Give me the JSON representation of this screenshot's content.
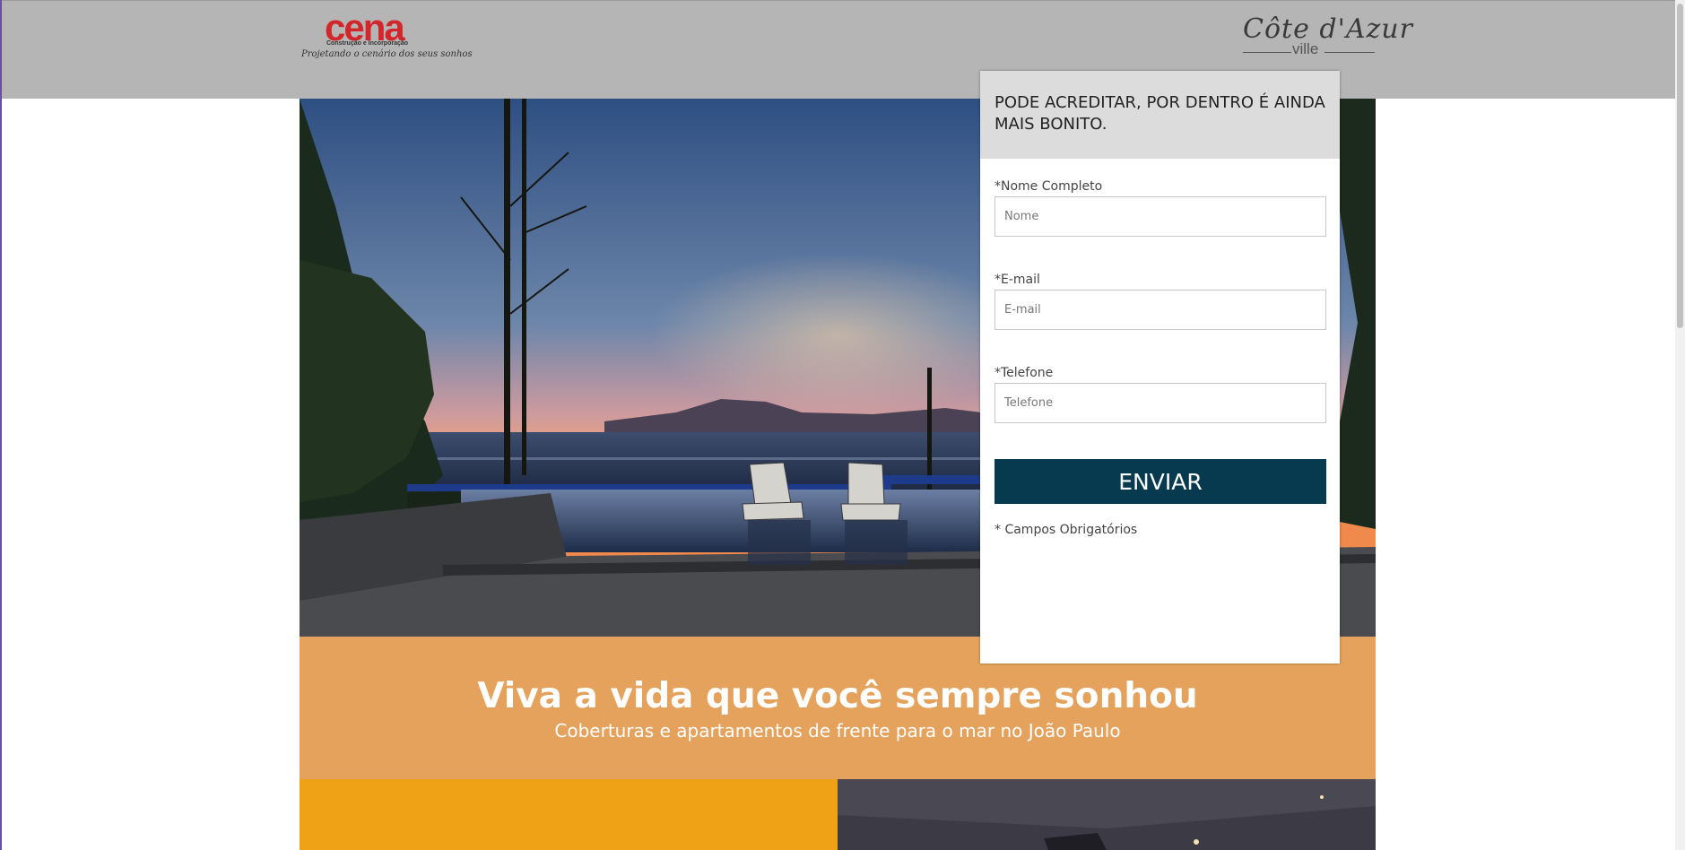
{
  "header": {
    "brand_logo": {
      "name": "cena",
      "subtitle": "Construção e Incorporação",
      "tagline": "Projetando o cenário dos seus sonhos"
    },
    "project_logo": {
      "name": "Côte d'Azur",
      "sub": "ville"
    }
  },
  "form": {
    "title": "PODE ACREDITAR, POR DENTRO É AINDA MAIS BONITO.",
    "fields": [
      {
        "label": "*Nome Completo",
        "placeholder": "Nome",
        "value": ""
      },
      {
        "label": "*E-mail",
        "placeholder": "E-mail",
        "value": ""
      },
      {
        "label": "*Telefone",
        "placeholder": "Telefone",
        "value": ""
      }
    ],
    "submit_label": "ENVIAR",
    "required_note": "* Campos Obrigatórios"
  },
  "banner": {
    "title": "Viva a vida que você sempre sonhou",
    "subtitle": "Coberturas e apartamentos de frente para o mar no João Paulo"
  },
  "colors": {
    "header_bg": "#b5b5b5",
    "banner_bg": "#e5a25c",
    "tile_orange": "#f0a217",
    "submit_bg": "#083a4f",
    "brand_red": "#d3262b"
  }
}
